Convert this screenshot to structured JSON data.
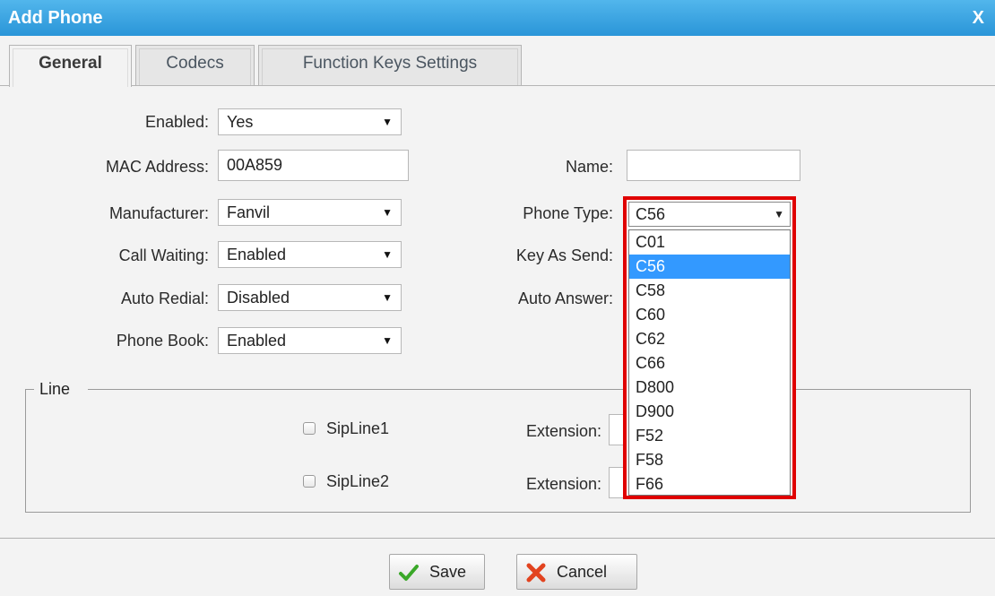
{
  "window": {
    "title": "Add Phone",
    "close_label": "X"
  },
  "tabs": [
    {
      "label": "General",
      "active": true
    },
    {
      "label": "Codecs",
      "active": false
    },
    {
      "label": "Function Keys Settings",
      "active": false
    }
  ],
  "form": {
    "enabled": {
      "label": "Enabled:",
      "value": "Yes"
    },
    "mac": {
      "label": "MAC Address:",
      "value": "00A859"
    },
    "name": {
      "label": "Name:",
      "value": ""
    },
    "manufacturer": {
      "label": "Manufacturer:",
      "value": "Fanvil"
    },
    "phone_type": {
      "label": "Phone Type:",
      "value": "C56"
    },
    "call_waiting": {
      "label": "Call Waiting:",
      "value": "Enabled"
    },
    "key_as_send": {
      "label": "Key As Send:"
    },
    "auto_redial": {
      "label": "Auto Redial:",
      "value": "Disabled"
    },
    "auto_answer": {
      "label": "Auto Answer:"
    },
    "phone_book": {
      "label": "Phone Book:",
      "value": "Enabled"
    }
  },
  "phone_type_options": [
    "C01",
    "C56",
    "C58",
    "C60",
    "C62",
    "C66",
    "D800",
    "D900",
    "F52",
    "F58",
    "F66"
  ],
  "phone_type_selected": "C56",
  "line": {
    "legend": "Line",
    "rows": [
      {
        "checkbox_label": "SipLine1",
        "extension_label": "Extension:",
        "checked": false
      },
      {
        "checkbox_label": "SipLine2",
        "extension_label": "Extension:",
        "checked": false
      }
    ]
  },
  "buttons": {
    "save": "Save",
    "cancel": "Cancel"
  },
  "colors": {
    "titlebar": "#2a95d8",
    "highlight": "#3399ff",
    "annotation": "#e00000"
  }
}
